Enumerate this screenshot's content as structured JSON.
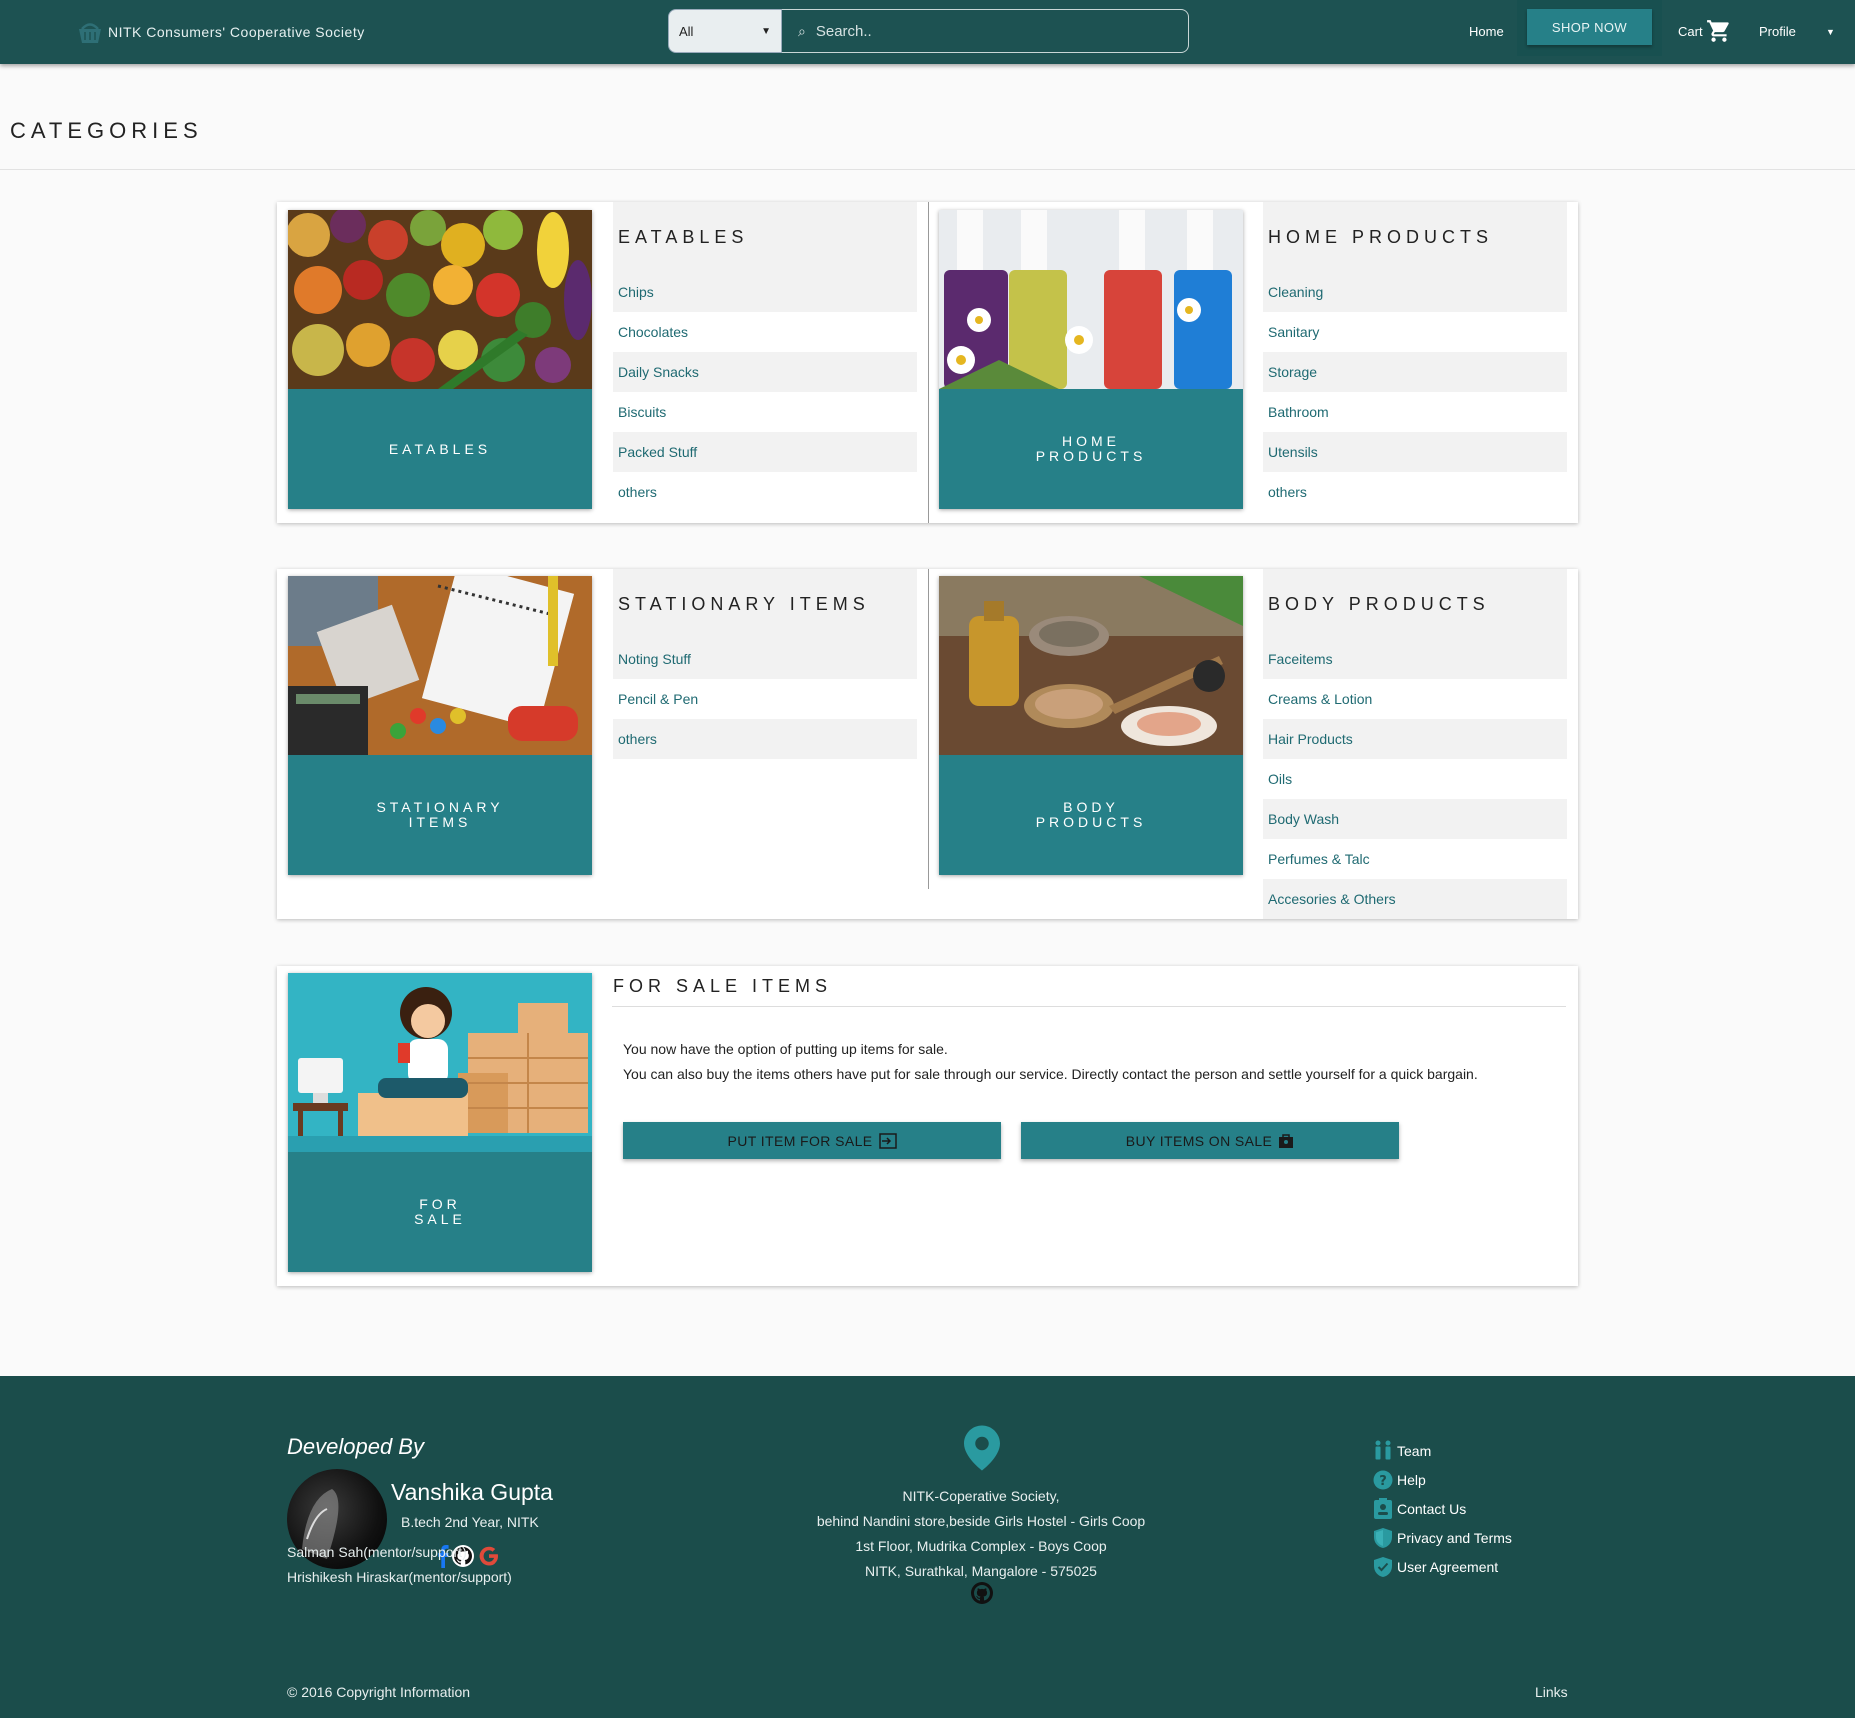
{
  "navbar": {
    "brand": "NITK Consumers' Cooperative Society",
    "search_category": "All",
    "search_placeholder": "Search..",
    "home": "Home",
    "shop_now": "SHOP NOW",
    "cart": "Cart",
    "profile": "Profile"
  },
  "page_title": "CATEGORIES",
  "categories": [
    {
      "card_label": "EATABLES",
      "heading": "EATABLES",
      "items": [
        "Chips",
        "Chocolates",
        "Daily Snacks",
        "Biscuits",
        "Packed Stuff",
        "others"
      ]
    },
    {
      "card_label_1": "HOME",
      "card_label_2": "PRODUCTS",
      "heading": "HOME PRODUCTS",
      "items": [
        "Cleaning",
        "Sanitary",
        "Storage",
        "Bathroom",
        "Utensils",
        "others"
      ]
    },
    {
      "card_label_1": "STATIONARY",
      "card_label_2": "ITEMS",
      "heading": "STATIONARY ITEMS",
      "items": [
        "Noting Stuff",
        "Pencil & Pen",
        "others"
      ]
    },
    {
      "card_label_1": "BODY",
      "card_label_2": "PRODUCTS",
      "heading": "BODY PRODUCTS",
      "items": [
        "Faceitems",
        "Creams & Lotion",
        "Hair Products",
        "Oils",
        "Body Wash",
        "Perfumes & Talc",
        "Accesories & Others"
      ]
    }
  ],
  "for_sale": {
    "card_label_1": "FOR",
    "card_label_2": "SALE",
    "heading": "FOR SALE ITEMS",
    "line1": "You now have the option of putting up items for sale.",
    "line2": "You can also buy the items others have put for sale through our service. Directly contact the person and settle yourself for a quick bargain.",
    "put_button": "PUT ITEM FOR SALE",
    "buy_button": "BUY ITEMS ON SALE"
  },
  "footer": {
    "developed_by": "Developed By",
    "dev_name": "Vanshika Gupta",
    "dev_sub": "B.tech 2nd Year, NITK",
    "mentor1": "Salman Sah(mentor/support)",
    "mentor2": "Hrishikesh Hiraskar(mentor/support)",
    "address": [
      "NITK-Coperative Society,",
      "behind Nandini store,beside Girls Hostel - Girls Coop",
      "1st Floor, Mudrika Complex - Boys Coop",
      "NITK, Surathkal, Mangalore - 575025"
    ],
    "links": [
      "Team",
      "Help",
      "Contact Us",
      "Privacy and Terms",
      "User Agreement"
    ],
    "copyright": "© 2016 Copyright Information",
    "links_label": "Links"
  },
  "colors": {
    "nav": "#1d5252",
    "accent": "#268088",
    "link": "#1f6a72",
    "footer": "#1b4d4b"
  }
}
